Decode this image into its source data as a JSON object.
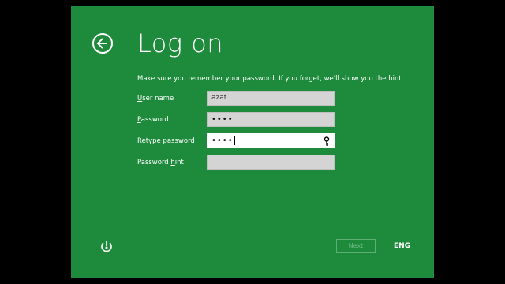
{
  "header": {
    "title": "Log on",
    "back_icon": "back-arrow-icon"
  },
  "description": "Make sure you remember your password. If you forget, we'll show you the hint.",
  "fields": {
    "user_name": {
      "label_first": "U",
      "label_rest": "ser name",
      "value": "azat"
    },
    "password": {
      "label_first": "P",
      "label_rest": "assword",
      "value": "••••"
    },
    "retype": {
      "label_first": "R",
      "label_rest": "etype password",
      "value": "••••"
    },
    "hint": {
      "label_prefix": "Password ",
      "label_ul": "h",
      "label_rest": "int",
      "value": ""
    }
  },
  "footer": {
    "next_label": "Next",
    "language": "ENG",
    "ease_icon": "ease-of-access-icon"
  },
  "colors": {
    "background": "#1e8a3c",
    "frame": "#000000",
    "field": "#d4d4d4"
  }
}
